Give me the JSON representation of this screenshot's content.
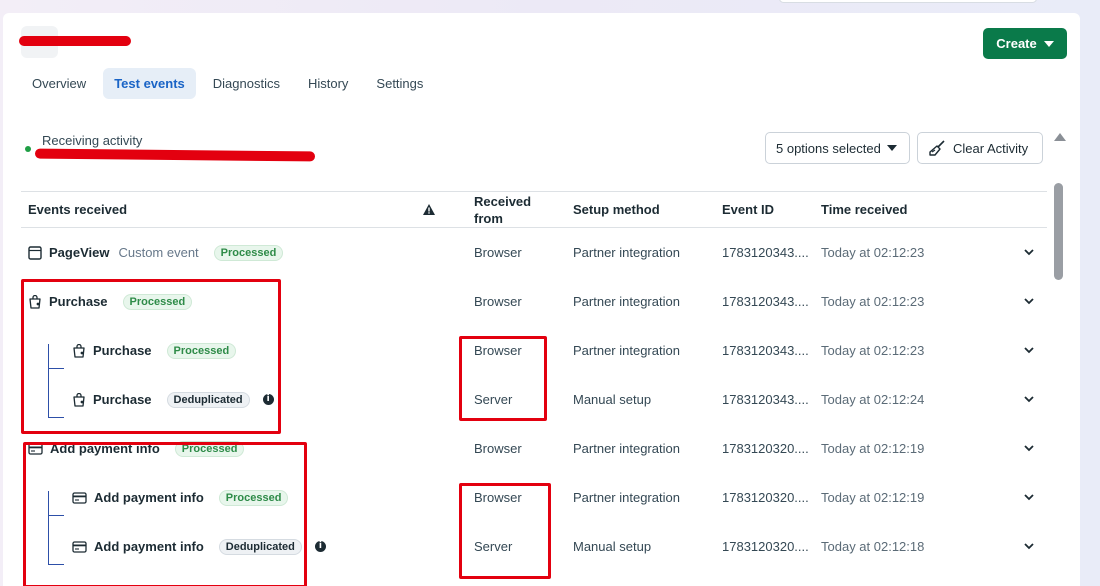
{
  "header": {
    "create_label": "Create"
  },
  "tabs": [
    {
      "label": "Overview",
      "active": false
    },
    {
      "label": "Test events",
      "active": true
    },
    {
      "label": "Diagnostics",
      "active": false
    },
    {
      "label": "History",
      "active": false
    },
    {
      "label": "Settings",
      "active": false
    }
  ],
  "activity": {
    "label": "Receiving activity",
    "status_color": "#1f9e45"
  },
  "controls": {
    "options_select": "5 options selected",
    "clear_label": "Clear Activity"
  },
  "table": {
    "headers": {
      "events": "Events received",
      "from": "Received from",
      "setup": "Setup method",
      "event_id": "Event ID",
      "time": "Time received"
    },
    "rows": [
      {
        "icon": "page-icon",
        "name": "PageView",
        "sub": "Custom event",
        "badge": "Processed",
        "from": "Browser",
        "setup": "Partner integration",
        "event_id": "1783120343....",
        "time": "Today at 02:12:23"
      },
      {
        "icon": "cart-icon",
        "name": "Purchase",
        "sub": "",
        "badge": "Processed",
        "from": "Browser",
        "setup": "Partner integration",
        "event_id": "1783120343....",
        "time": "Today at 02:12:23"
      },
      {
        "icon": "cart-icon",
        "name": "Purchase",
        "sub": "",
        "badge": "Processed",
        "from": "Browser",
        "setup": "Partner integration",
        "event_id": "1783120343....",
        "time": "Today at 02:12:23"
      },
      {
        "icon": "cart-icon",
        "name": "Purchase",
        "sub": "",
        "badge": "Deduplicated",
        "from": "Server",
        "setup": "Manual setup",
        "event_id": "1783120343....",
        "time": "Today at 02:12:24"
      },
      {
        "icon": "card-icon",
        "name": "Add payment info",
        "sub": "",
        "badge": "Processed",
        "from": "Browser",
        "setup": "Partner integration",
        "event_id": "1783120320....",
        "time": "Today at 02:12:19"
      },
      {
        "icon": "card-icon",
        "name": "Add payment info",
        "sub": "",
        "badge": "Processed",
        "from": "Browser",
        "setup": "Partner integration",
        "event_id": "1783120320....",
        "time": "Today at 02:12:19"
      },
      {
        "icon": "card-icon",
        "name": "Add payment info",
        "sub": "",
        "badge": "Deduplicated",
        "from": "Server",
        "setup": "Manual setup",
        "event_id": "1783120320....",
        "time": "Today at 02:12:18"
      }
    ]
  },
  "colors": {
    "accent": "#1a64c6",
    "create_button": "#0a7a4a",
    "annotation": "#e3000f",
    "tree_line": "#2d4fa8"
  }
}
